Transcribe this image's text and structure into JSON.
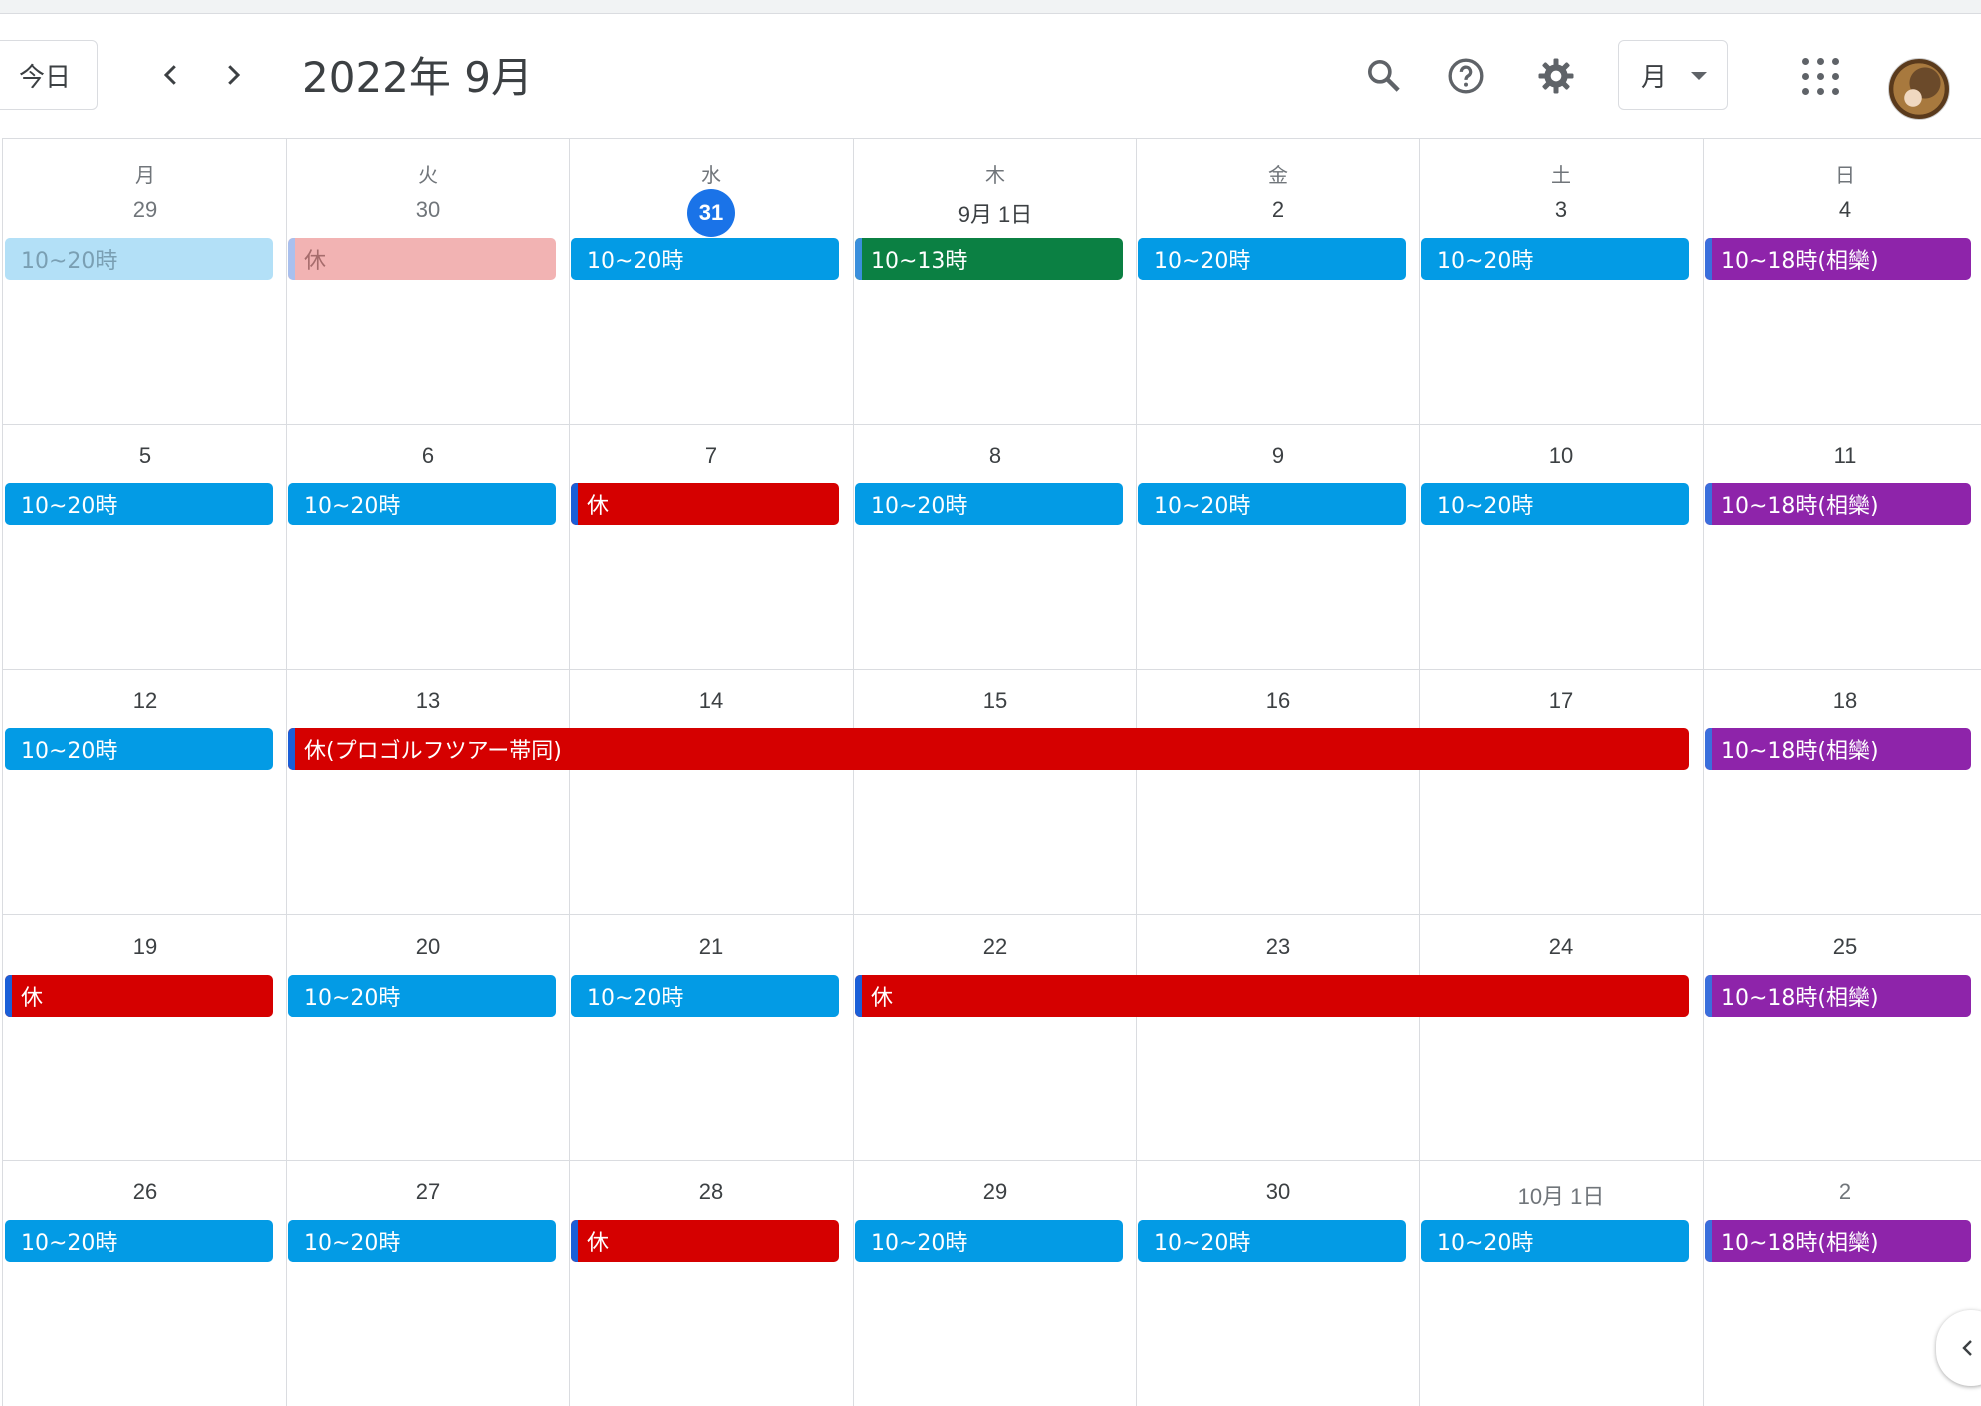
{
  "header": {
    "today_label": "今日",
    "title": "2022年 9月",
    "view_label": "月"
  },
  "weekdays": [
    "月",
    "火",
    "水",
    "木",
    "金",
    "土",
    "日"
  ],
  "weeks": [
    {
      "days": [
        "29",
        "30",
        "31",
        "9月 1日",
        "2",
        "3",
        "4"
      ]
    },
    {
      "days": [
        "5",
        "6",
        "7",
        "8",
        "9",
        "10",
        "11"
      ]
    },
    {
      "days": [
        "12",
        "13",
        "14",
        "15",
        "16",
        "17",
        "18"
      ]
    },
    {
      "days": [
        "19",
        "20",
        "21",
        "22",
        "23",
        "24",
        "25"
      ]
    },
    {
      "days": [
        "26",
        "27",
        "28",
        "29",
        "30",
        "10月 1日",
        "2"
      ]
    }
  ],
  "events": {
    "w0": [
      "10~20時",
      "休",
      "10~20時",
      "10~13時",
      "10~20時",
      "10~20時",
      "10~18時(相欒)"
    ],
    "w1": [
      "10~20時",
      "10~20時",
      "休",
      "10~20時",
      "10~20時",
      "10~20時",
      "10~18時(相欒)"
    ],
    "w2": [
      "10~20時",
      "休(プロゴルフツアー帯同)",
      "10~18時(相欒)"
    ],
    "w3": [
      "休",
      "10~20時",
      "10~20時",
      "休",
      "10~18時(相欒)"
    ],
    "w4": [
      "10~20時",
      "10~20時",
      "休",
      "10~20時",
      "10~20時",
      "10~20時",
      "10~18時(相欒)"
    ]
  },
  "colors": {
    "blue": "#039be5",
    "red": "#d50000",
    "purple": "#8e24aa",
    "green": "#0b8043",
    "today": "#1a73e8"
  }
}
